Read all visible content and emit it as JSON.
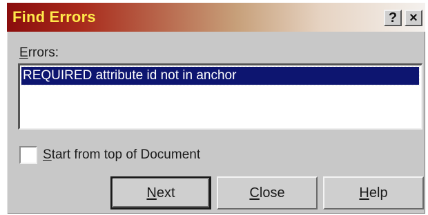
{
  "dialog": {
    "title": "Find Errors",
    "help_button": "?",
    "close_button": "×"
  },
  "errors_section": {
    "label_mnemonic": "E",
    "label_rest": "rrors:",
    "items": [
      {
        "text": "REQUIRED attribute id not in anchor",
        "selected": true
      }
    ]
  },
  "options": {
    "start_from_top": {
      "mnemonic": "S",
      "label_rest": "tart from top of Document",
      "checked": false
    }
  },
  "buttons": {
    "next": {
      "mnemonic": "N",
      "rest": "ext"
    },
    "close": {
      "mnemonic": "C",
      "rest": "lose"
    },
    "help": {
      "mnemonic": "H",
      "rest": "elp"
    }
  },
  "colors": {
    "title_text": "#ffe94a",
    "title_bar_start": "#8a0d0d",
    "selection": "#0d1570",
    "dialog_face": "#c8c8c8"
  }
}
